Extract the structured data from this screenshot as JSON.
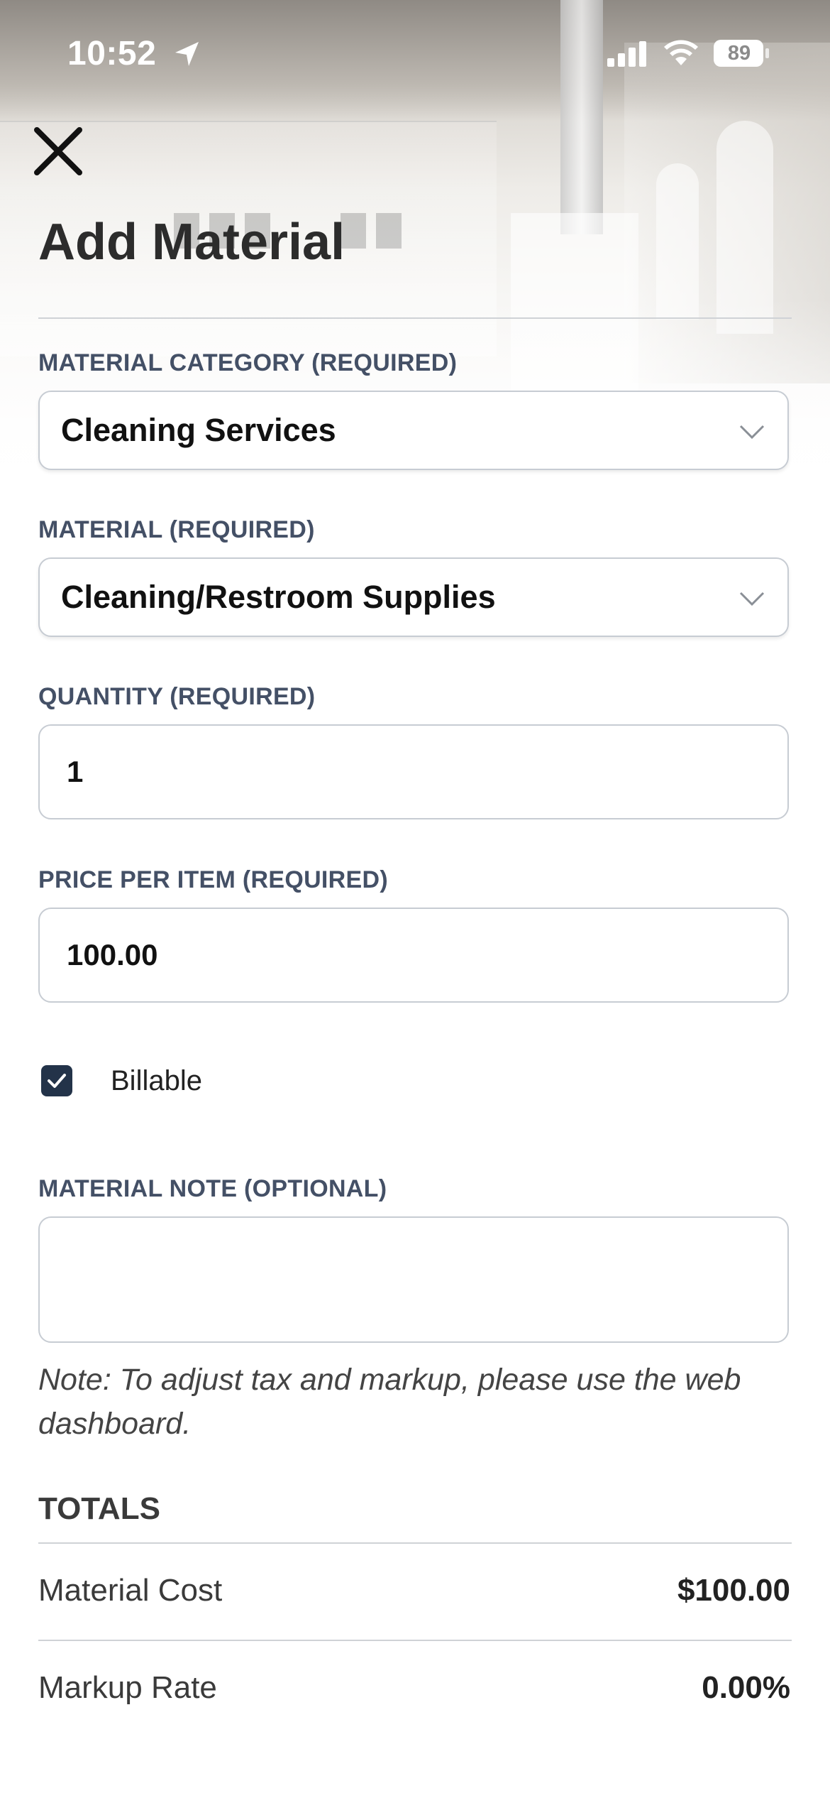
{
  "status_bar": {
    "time": "10:52",
    "battery": "89"
  },
  "header": {
    "title": "Add Material"
  },
  "form": {
    "category_label": "MATERIAL CATEGORY (REQUIRED)",
    "category_value": "Cleaning Services",
    "material_label": "MATERIAL (REQUIRED)",
    "material_value": "Cleaning/Restroom Supplies",
    "quantity_label": "QUANTITY (REQUIRED)",
    "quantity_value": "1",
    "price_label": "PRICE PER ITEM (REQUIRED)",
    "price_value": "100.00",
    "billable_label": "Billable",
    "billable_checked": true,
    "note_label": "MATERIAL NOTE (OPTIONAL)",
    "note_value": "",
    "tax_note": "Note: To adjust tax and markup, please use the web dashboard."
  },
  "totals": {
    "title": "TOTALS",
    "rows": [
      {
        "label": "Material Cost",
        "value": "$100.00"
      },
      {
        "label": "Markup Rate",
        "value": "0.00%"
      }
    ]
  },
  "colors": {
    "label_text": "#445066",
    "checkbox_fill": "#233349",
    "border": "#c7ccd3"
  }
}
